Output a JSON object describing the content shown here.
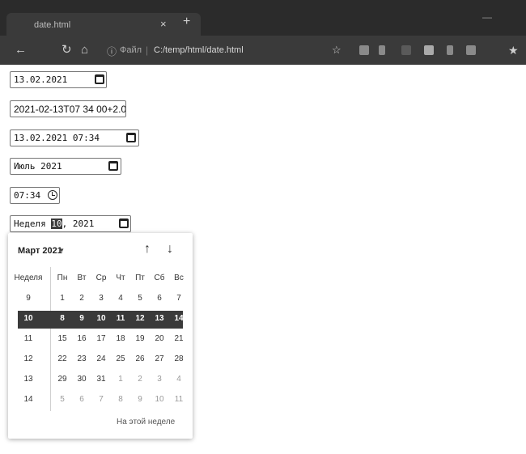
{
  "browser": {
    "tab_title": "date.html",
    "tab_close": "×",
    "new_tab": "+",
    "minimize": "—",
    "address_label": "Файл",
    "address_url": "C:/temp/html/date.html"
  },
  "inputs": {
    "date_value": "13.02.2021",
    "text_value": "2021-02-13T07 34 00+2.0(",
    "datetime_value": "13.02.2021 07:34",
    "month_value": "Июль 2021",
    "time_value": "07:34",
    "week_prefix": "Неделя ",
    "week_number": "10",
    "week_suffix": ", 2021"
  },
  "picker": {
    "month_label": "Март 2021",
    "caret": "▾",
    "prev_arrow": "↑",
    "next_arrow": "↓",
    "header": [
      "Неделя",
      "Пн",
      "Вт",
      "Ср",
      "Чт",
      "Пт",
      "Сб",
      "Вс"
    ],
    "rows": [
      [
        "9",
        "1",
        "2",
        "3",
        "4",
        "5",
        "6",
        "7"
      ],
      [
        "10",
        "8",
        "9",
        "10",
        "11",
        "12",
        "13",
        "14"
      ],
      [
        "11",
        "15",
        "16",
        "17",
        "18",
        "19",
        "20",
        "21"
      ],
      [
        "12",
        "22",
        "23",
        "24",
        "25",
        "26",
        "27",
        "28"
      ],
      [
        "13",
        "29",
        "30",
        "31",
        "1",
        "2",
        "3",
        "4"
      ],
      [
        "14",
        "5",
        "6",
        "7",
        "8",
        "9",
        "10",
        "11"
      ]
    ],
    "this_week": "На этой неделе"
  }
}
